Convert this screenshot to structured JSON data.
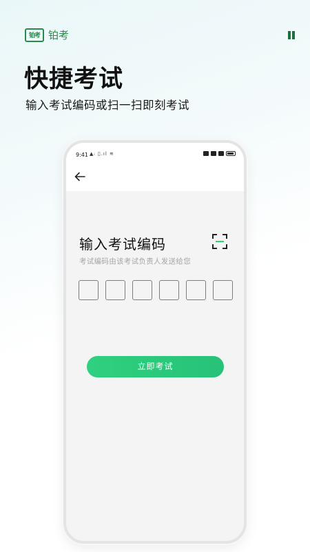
{
  "brand": {
    "logo_text": "铂考",
    "name": "铂考"
  },
  "hero": {
    "title": "快捷考试",
    "subtitle": "输入考试编码或扫一扫即刻考试"
  },
  "phone": {
    "status_bar": {
      "time": "9:41",
      "left_icons": "▲ᵢ ▯.ıl ≋",
      "right_icons": [
        "alarm-icon",
        "signal-icon",
        "wifi-icon",
        "battery-icon"
      ]
    },
    "screen": {
      "title": "输入考试编码",
      "hint": "考试编码由该考试负责人发送给您",
      "code_boxes": [
        "",
        "",
        "",
        "",
        "",
        ""
      ],
      "start_button": "立即考试"
    }
  },
  "colors": {
    "brand_green": "#2a8a4a",
    "button_green": "#2fd07f",
    "scan_accent": "#2fd07f"
  }
}
